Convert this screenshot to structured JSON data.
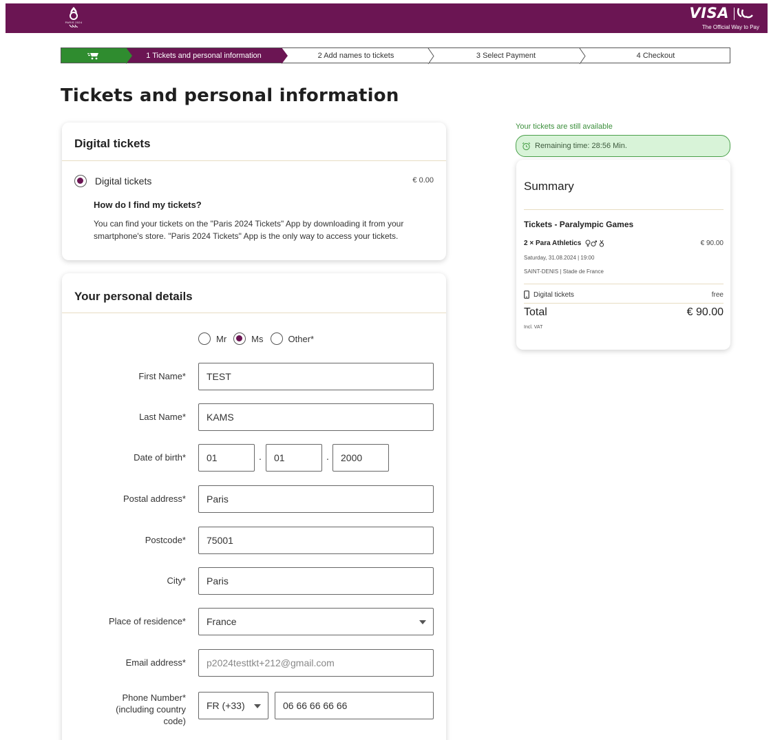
{
  "header": {
    "logo_text": "PARIS 2024",
    "visa_word": "VISA",
    "visa_tagline": "The Official Way to Pay"
  },
  "stepper": {
    "steps": [
      {
        "label": "1  Tickets and personal information",
        "state": "active"
      },
      {
        "label": "2  Add names to tickets",
        "state": "upcoming"
      },
      {
        "label": "3  Select Payment",
        "state": "upcoming"
      },
      {
        "label": "4  Checkout",
        "state": "upcoming"
      }
    ]
  },
  "page": {
    "title": "Tickets and personal information"
  },
  "digital_tickets": {
    "heading": "Digital tickets",
    "option_label": "Digital tickets",
    "option_price": "€ 0.00",
    "question": "How do I find my tickets?",
    "answer": "You can find your tickets on the \"Paris 2024 Tickets\" App by downloading it from your smartphone's store. \"Paris 2024 Tickets\" App is the only way to access your tickets."
  },
  "personal": {
    "heading": "Your personal details",
    "salutation": {
      "options": [
        "Mr",
        "Ms",
        "Other*"
      ],
      "selected": "Ms"
    },
    "first_name": {
      "label": "First Name*",
      "value": "TEST"
    },
    "last_name": {
      "label": "Last Name*",
      "value": "KAMS"
    },
    "dob": {
      "label": "Date of birth*",
      "day": "01",
      "month": "01",
      "year": "2000",
      "separator": "."
    },
    "postal_address": {
      "label": "Postal address*",
      "value": "Paris"
    },
    "postcode": {
      "label": "Postcode*",
      "value": "75001"
    },
    "city": {
      "label": "City*",
      "value": "Paris"
    },
    "residence": {
      "label": "Place of residence*",
      "value": "France"
    },
    "email": {
      "label": "Email address*",
      "value": "p2024testtkt+212@gmail.com"
    },
    "phone": {
      "label_1": "Phone Number*",
      "label_2": "(including country",
      "label_3": "code)",
      "country_code": "FR (+33)",
      "number": "06 66 66 66 66"
    }
  },
  "summary": {
    "availability": "Your tickets are still available",
    "remaining": "Remaining time: 28:56 Min.",
    "title": "Summary",
    "subtitle": "Tickets - Paralympic Games",
    "item": "2 × Para Athletics",
    "item_price": "€ 90.00",
    "date": "Saturday, 31.08.2024 | 19:00",
    "venue": "SAINT-DENIS | Stade de France",
    "delivery": "Digital tickets",
    "delivery_price": "free",
    "total_label": "Total",
    "total_value": "€ 90.00",
    "vat": "Incl. VAT"
  },
  "colors": {
    "brand": "#6b1553",
    "green": "#2f8c2f",
    "timer_bg": "#d8f3d8"
  }
}
